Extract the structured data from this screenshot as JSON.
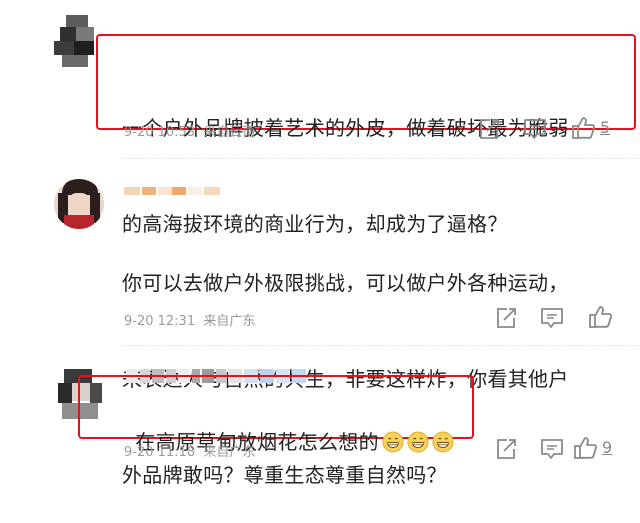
{
  "comments": [
    {
      "text_lines": [
        "一个户外品牌披着艺术的外皮，做着破坏最为脆弱",
        "的高海拔环境的商业行为，却成为了逼格？"
      ],
      "meta": "9-20 10:53  来自云南",
      "like_count": "5"
    },
    {
      "text_lines": [
        "你可以去做户外极限挑战，可以做户外各种运动，",
        "来表达人与自然的共生，非要这样炸，你看其他户",
        "外品牌敢吗？尊重生态尊重自然吗？"
      ],
      "meta": "9-20 12:31  来自广东",
      "like_count": ""
    },
    {
      "text_lines": [
        "在高原草甸放烟花怎么想的"
      ],
      "meta": "9-20 11:18  来自广东",
      "like_count": "9"
    }
  ],
  "emoji_count": 3,
  "icons": {
    "repost": "repost-icon",
    "comment": "comment-icon",
    "like": "thumbs-up-icon",
    "emoji": "grin-emoji-icon"
  },
  "colors": {
    "highlight_border": "#e4131b",
    "text": "#222222",
    "meta": "#9a9a9a",
    "icon": "#8a8a8a"
  }
}
